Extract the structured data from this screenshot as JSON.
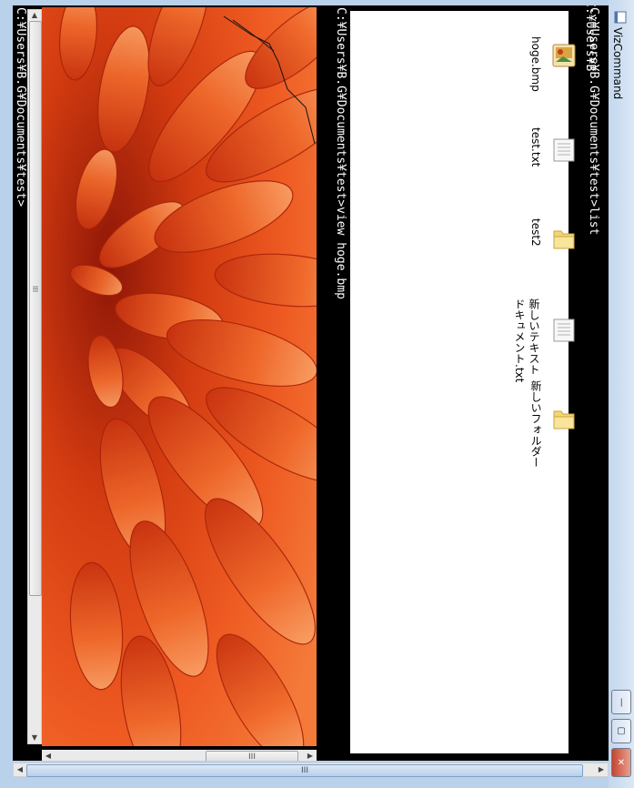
{
  "window": {
    "title": "VizCommand",
    "buttons": {
      "minimize": "—",
      "maximize": "▢",
      "close": "✕"
    }
  },
  "console": {
    "line1": "C:¥Users¥B.G¥Documents¥test",
    "line2": "C:¥Users¥B.G¥Documents¥test>list",
    "line3": "C:¥Users¥B.G¥Documents¥test>view hoge.bmp",
    "prompt": "C:¥Users¥B.G¥Documents¥test>"
  },
  "files": [
    {
      "name": "hoge.bmp",
      "icon": "bitmap-icon"
    },
    {
      "name": "test.txt",
      "icon": "text-file-icon"
    },
    {
      "name": "test2",
      "icon": "folder-icon"
    },
    {
      "name": "新しいテキスト\nドキュメント.txt",
      "icon": "text-file-icon"
    },
    {
      "name": "新しいフォルダー",
      "icon": "folder-icon"
    }
  ],
  "scrollbars": {
    "grip": "III"
  },
  "colors": {
    "accent": "#e4572e",
    "background": "#000000"
  }
}
